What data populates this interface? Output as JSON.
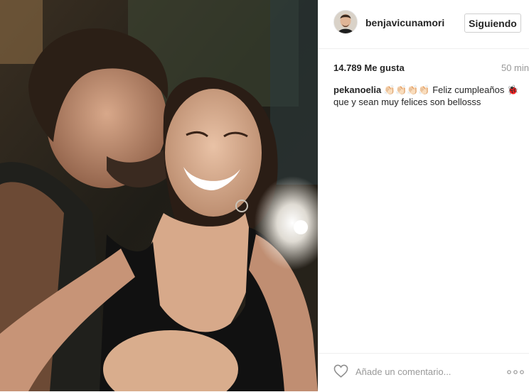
{
  "post": {
    "photo_alt": "selfie"
  },
  "header": {
    "username": "benjavicunamori",
    "follow_label": "Siguiendo"
  },
  "stats": {
    "likes": "14.789 Me gusta",
    "time": "50 min"
  },
  "caption": {
    "user": "pekanoelia",
    "emoji_1": "👏🏻👏🏻👏🏻👏🏻",
    "text_1": " Feliz cumpleaños ",
    "emoji_2": "🐞",
    "text_2": "que y sean muy felices son bellosss"
  },
  "comment": {
    "placeholder": "Añade un comentario..."
  },
  "icons": {
    "like": "heart-icon",
    "more": "more-options-icon"
  }
}
